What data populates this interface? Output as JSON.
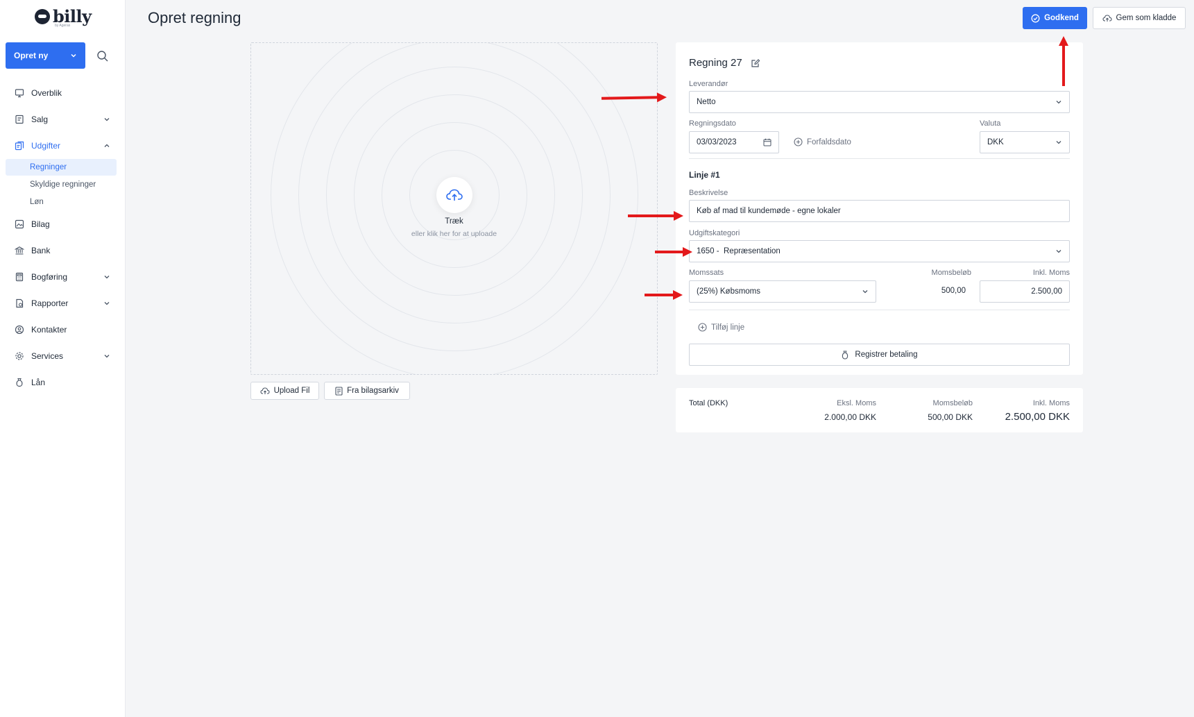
{
  "brand": {
    "name": "billy",
    "tagline": "by Ageras"
  },
  "sidebar": {
    "create_label": "Opret ny",
    "items": [
      {
        "label": "Overblik",
        "icon": "dashboard-icon"
      },
      {
        "label": "Salg",
        "icon": "sales-icon"
      },
      {
        "label": "Udgifter",
        "icon": "expenses-icon"
      },
      {
        "label": "Bilag",
        "icon": "receipt-icon"
      },
      {
        "label": "Bank",
        "icon": "bank-icon"
      },
      {
        "label": "Bogføring",
        "icon": "calculator-icon"
      },
      {
        "label": "Rapporter",
        "icon": "reports-icon"
      },
      {
        "label": "Kontakter",
        "icon": "contacts-icon"
      },
      {
        "label": "Services",
        "icon": "services-icon"
      },
      {
        "label": "Lån",
        "icon": "loan-icon"
      }
    ],
    "sub_items": [
      "Regninger",
      "Skyldige regninger",
      "Løn"
    ]
  },
  "header": {
    "title": "Opret regning",
    "approve_label": "Godkend",
    "draft_label": "Gem som kladde"
  },
  "dropzone": {
    "title": "Træk",
    "subtitle": "eller klik her for at uploade",
    "upload_label": "Upload Fil",
    "archive_label": "Fra bilagsarkiv"
  },
  "form": {
    "bill_title": "Regning 27",
    "vendor_label": "Leverandør",
    "vendor_value": "Netto",
    "date_label": "Regningsdato",
    "date_value": "03/03/2023",
    "due_label": "Forfaldsdato",
    "currency_label": "Valuta",
    "currency_value": "DKK",
    "line_title": "Linje #1",
    "desc_label": "Beskrivelse",
    "desc_value": "Køb af mad til kundemøde - egne lokaler",
    "category_label": "Udgiftskategori",
    "category_value": "1650 -  Repræsentation",
    "vat_label": "Momssats",
    "vat_value": "(25%) Købsmoms",
    "vat_amount_label": "Momsbeløb",
    "vat_amount_value": "500,00",
    "incl_label": "Inkl. Moms",
    "incl_value": "2.500,00",
    "add_line_label": "Tilføj linje",
    "pay_label": "Registrer betaling"
  },
  "totals": {
    "label": "Total (DKK)",
    "excl_label": "Eksl. Moms",
    "excl_value": "2.000,00 DKK",
    "vat_label": "Momsbeløb",
    "vat_value": "500,00 DKK",
    "incl_label": "Inkl. Moms",
    "incl_value": "2.500,00 DKK"
  },
  "colors": {
    "accent": "#2e6ef0",
    "annotation": "#e3191b",
    "background": "#f4f5f7"
  }
}
